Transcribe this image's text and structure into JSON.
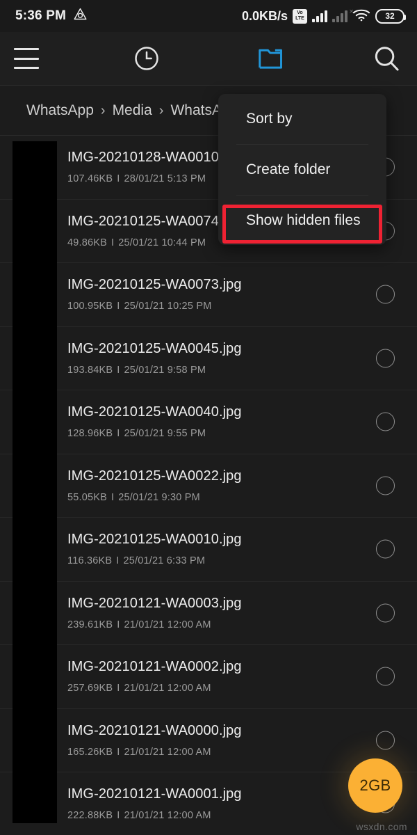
{
  "statusbar": {
    "time": "5:36 PM",
    "left_icon": "triangle-recycle-icon",
    "network_speed": "0.0KB/s",
    "volte_top": "Vo",
    "volte_bottom": "LTE",
    "battery_level": "32"
  },
  "toolbar": {
    "menu_icon": "hamburger-menu-icon",
    "recent_icon": "clock-icon",
    "folder_icon": "folder-icon",
    "search_icon": "search-icon",
    "folder_active_color": "#2196d9"
  },
  "breadcrumb": {
    "separator": "›",
    "items": [
      "WhatsApp",
      "Media",
      "WhatsApp"
    ]
  },
  "menu": {
    "items": [
      {
        "label": "Sort by"
      },
      {
        "label": "Create folder"
      },
      {
        "label": "Show hidden files"
      }
    ],
    "highlight_color": "#ef2233",
    "highlighted_index": 2
  },
  "fab": {
    "label": "2GB",
    "color": "#fbb034"
  },
  "watermark": {
    "text": "wsxdn.com"
  },
  "files": [
    {
      "name": "IMG-20210128-WA0010.",
      "size": "107.46KB",
      "date": "28/01/21 5:13 PM"
    },
    {
      "name": "IMG-20210125-WA0074.",
      "size": "49.86KB",
      "date": "25/01/21 10:44 PM"
    },
    {
      "name": "IMG-20210125-WA0073.jpg",
      "size": "100.95KB",
      "date": "25/01/21 10:25 PM"
    },
    {
      "name": "IMG-20210125-WA0045.jpg",
      "size": "193.84KB",
      "date": "25/01/21 9:58 PM"
    },
    {
      "name": "IMG-20210125-WA0040.jpg",
      "size": "128.96KB",
      "date": "25/01/21 9:55 PM"
    },
    {
      "name": "IMG-20210125-WA0022.jpg",
      "size": "55.05KB",
      "date": "25/01/21 9:30 PM"
    },
    {
      "name": "IMG-20210125-WA0010.jpg",
      "size": "116.36KB",
      "date": "25/01/21 6:33 PM"
    },
    {
      "name": "IMG-20210121-WA0003.jpg",
      "size": "239.61KB",
      "date": "21/01/21 12:00 AM"
    },
    {
      "name": "IMG-20210121-WA0002.jpg",
      "size": "257.69KB",
      "date": "21/01/21 12:00 AM"
    },
    {
      "name": "IMG-20210121-WA0000.jpg",
      "size": "165.26KB",
      "date": "21/01/21 12:00 AM"
    },
    {
      "name": "IMG-20210121-WA0001.jpg",
      "size": "222.88KB",
      "date": "21/01/21 12:00 AM"
    }
  ]
}
